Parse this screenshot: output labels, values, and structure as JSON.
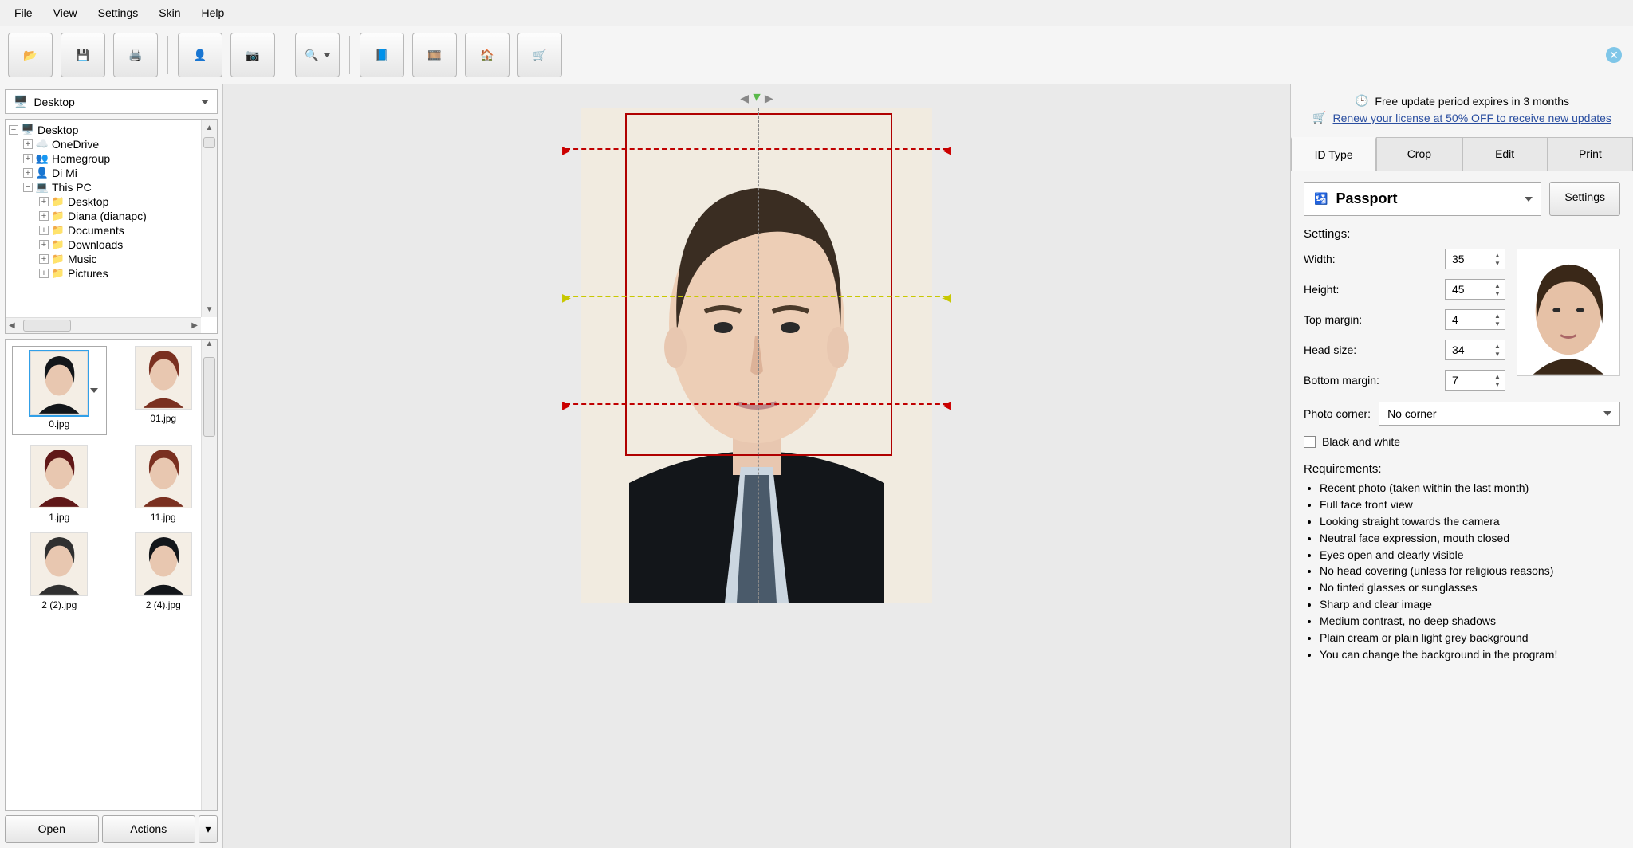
{
  "menu": {
    "file": "File",
    "view": "View",
    "settings": "Settings",
    "skin": "Skin",
    "help": "Help"
  },
  "promo": {
    "line1": "Free update period expires in 3 months",
    "line2": "Renew your license at 50% OFF to receive new updates"
  },
  "location_dropdown": "Desktop",
  "tree": {
    "root": "Desktop",
    "items": [
      {
        "label": "OneDrive",
        "depth": 1,
        "twisty": "+"
      },
      {
        "label": "Homegroup",
        "depth": 1,
        "twisty": "+"
      },
      {
        "label": "Di Mi",
        "depth": 1,
        "twisty": "+"
      },
      {
        "label": "This PC",
        "depth": 1,
        "twisty": "−"
      },
      {
        "label": "Desktop",
        "depth": 2,
        "twisty": "+"
      },
      {
        "label": "Diana (dianapc)",
        "depth": 2,
        "twisty": "+"
      },
      {
        "label": "Documents",
        "depth": 2,
        "twisty": "+"
      },
      {
        "label": "Downloads",
        "depth": 2,
        "twisty": "+"
      },
      {
        "label": "Music",
        "depth": 2,
        "twisty": "+"
      },
      {
        "label": "Pictures",
        "depth": 2,
        "twisty": "+"
      }
    ]
  },
  "thumbs": [
    {
      "name": "0.jpg",
      "selected": true
    },
    {
      "name": "01.jpg",
      "selected": false
    },
    {
      "name": "1.jpg",
      "selected": false
    },
    {
      "name": "11.jpg",
      "selected": false
    },
    {
      "name": "2 (2).jpg",
      "selected": false
    },
    {
      "name": "2 (4).jpg",
      "selected": false
    }
  ],
  "buttons": {
    "open": "Open",
    "actions": "Actions"
  },
  "tabs": {
    "idtype": "ID Type",
    "crop": "Crop",
    "edit": "Edit",
    "print": "Print"
  },
  "idtype": {
    "type_label": "Passport",
    "settings_btn": "Settings",
    "settings_hdr": "Settings:",
    "width_lbl": "Width:",
    "width_val": "35",
    "height_lbl": "Height:",
    "height_val": "45",
    "topmargin_lbl": "Top margin:",
    "topmargin_val": "4",
    "headsize_lbl": "Head size:",
    "headsize_val": "34",
    "bottommargin_lbl": "Bottom margin:",
    "bottommargin_val": "7",
    "corner_lbl": "Photo corner:",
    "corner_val": "No corner",
    "bw_lbl": "Black and white",
    "req_hdr": "Requirements:",
    "reqs": [
      "Recent photo (taken within the last month)",
      "Full face front view",
      "Looking straight towards the camera",
      "Neutral face expression, mouth closed",
      "Eyes open and clearly visible",
      "No head covering (unless for religious reasons)",
      "No tinted glasses or sunglasses",
      "Sharp and clear image",
      "Medium contrast, no deep shadows",
      "Plain cream or plain light grey background",
      "You can change the background in the program!"
    ]
  }
}
